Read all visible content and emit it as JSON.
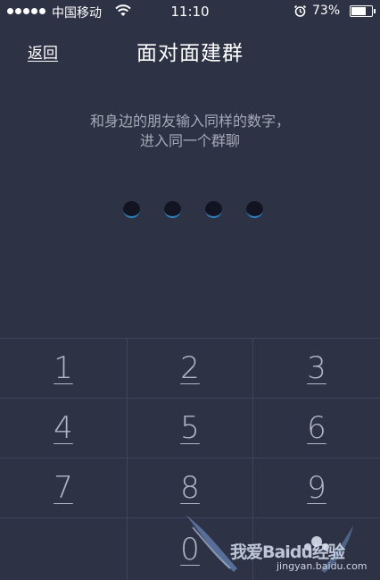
{
  "status_bar": {
    "carrier": "中国移动",
    "time": "11:10",
    "battery": "73%",
    "icons": [
      "signal-dots",
      "wifi-icon",
      "alarm-icon",
      "battery-icon"
    ]
  },
  "nav": {
    "back_label": "返回",
    "title": "面对面建群"
  },
  "instruction": {
    "line1": "和身边的朋友输入同样的数字，",
    "line2": "进入同一个群聊"
  },
  "pin": {
    "digits_entered": 0,
    "length": 4
  },
  "keypad": {
    "keys": [
      "1",
      "2",
      "3",
      "4",
      "5",
      "6",
      "7",
      "8",
      "9",
      "",
      "0",
      ""
    ]
  },
  "watermark": {
    "main": "我爱Baidu经验",
    "sub": "jingyan.baidu.com"
  },
  "colors": {
    "background": "#2e3245",
    "instruction_text": "#a6a9b6",
    "key_text": "#b4b7c3",
    "divider": "#3f4458",
    "pin_dot": "#121521",
    "pin_accent": "#2f86c4"
  }
}
